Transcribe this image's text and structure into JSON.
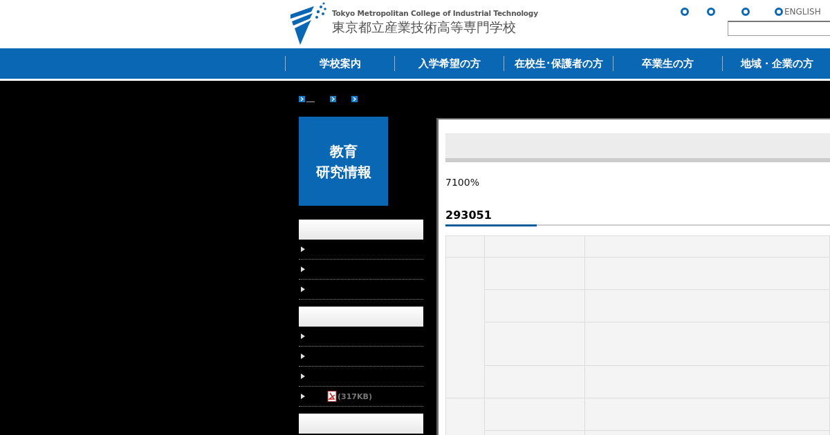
{
  "header": {
    "logo_en": "Tokyo Metropolitan College of Industrial Technology",
    "logo_ja": "東京都立産業技術高等専門学校",
    "english_link": "ENGLISH"
  },
  "nav": [
    "学校案内",
    "入学希望の方",
    "在校生･保護者の方",
    "卒業生の方",
    "地域・企業の方"
  ],
  "sidebar": {
    "banner": [
      "教育",
      "研究情報"
    ],
    "sections": [
      {
        "kind": "list",
        "items": [
          {
            "kind": "link"
          },
          {
            "kind": "link"
          },
          {
            "kind": "link"
          }
        ]
      },
      {
        "kind": "list",
        "items": [
          {
            "kind": "link"
          },
          {
            "kind": "link"
          },
          {
            "kind": "link"
          },
          {
            "kind": "pdf",
            "size": "(317KB)"
          }
        ]
      },
      {
        "kind": "heading"
      }
    ]
  },
  "main": {
    "lead": "7100%",
    "heading": "293051"
  }
}
